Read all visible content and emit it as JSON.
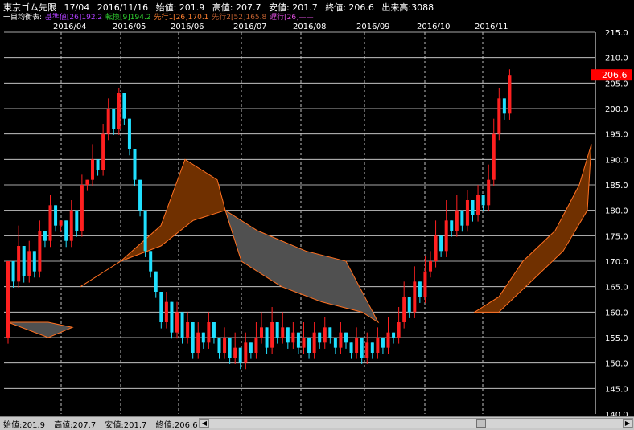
{
  "header": {
    "symbol": "東京ゴム先限",
    "contract": "17/04",
    "date": "2016/11/16",
    "open": "始値: 201.9",
    "high": "高値: 207.7",
    "low": "安値: 201.7",
    "close": "終値: 206.6",
    "volume": "出来高:3088"
  },
  "legend": {
    "prefix": "一目均衡表:",
    "kijun": "基準値[26]192.2",
    "tenkan": "転換[9]194.2",
    "senko1": "先行1[26]170.1",
    "senko2": "先行2[52]165.8",
    "chikou": "遅行[26]——"
  },
  "colors": {
    "up": "#ff2020",
    "down": "#20e0ff",
    "kijun": "#9020ff",
    "tenkan": "#20b020",
    "senko1": "#ff7020",
    "senko2": "#a05020",
    "chikou": "#d040d0",
    "cloud_bull": "#703000",
    "cloud_bear": "#505050",
    "price_tag": "#ff0000"
  },
  "footer": {
    "open": "始値:201.9",
    "high": "高値:207.7",
    "low": "安値:201.7",
    "close": "終値:206.6"
  },
  "chart_data": {
    "type": "candlestick",
    "ylim": [
      140,
      215
    ],
    "y_ticks": [
      "140.0",
      "145.0",
      "150.0",
      "155.0",
      "160.0",
      "165.0",
      "170.0",
      "175.0",
      "180.0",
      "185.0",
      "190.0",
      "195.0",
      "200.0",
      "205.0",
      "210.0",
      "215.0"
    ],
    "month_labels": [
      "2016/04",
      "2016/05",
      "2016/06",
      "2016/07",
      "2016/08",
      "2016/09",
      "2016/10",
      "2016/11"
    ],
    "last_price": "206.6",
    "candles": [
      [
        155,
        170,
        165
      ],
      [
        170,
        166,
        164
      ],
      [
        166,
        173,
        177
      ],
      [
        173,
        167,
        165
      ],
      [
        167,
        172,
        174
      ],
      [
        172,
        168,
        166
      ],
      [
        168,
        176,
        178
      ],
      [
        176,
        174,
        172
      ],
      [
        174,
        181,
        183
      ],
      [
        181,
        177,
        176
      ],
      [
        177,
        178,
        172
      ],
      [
        178,
        174,
        173
      ],
      [
        174,
        180,
        182
      ],
      [
        180,
        176,
        174
      ],
      [
        176,
        185,
        187
      ],
      [
        185,
        186,
        182
      ],
      [
        186,
        190,
        193
      ],
      [
        190,
        188,
        185
      ],
      [
        188,
        195,
        197
      ],
      [
        195,
        200,
        202
      ],
      [
        200,
        196,
        194
      ],
      [
        196,
        203,
        204
      ],
      [
        203,
        198,
        196
      ],
      [
        198,
        192,
        190
      ],
      [
        192,
        186,
        185
      ],
      [
        186,
        180,
        178
      ],
      [
        180,
        172,
        170
      ],
      [
        172,
        168,
        167
      ],
      [
        168,
        164,
        162
      ],
      [
        164,
        158,
        157
      ],
      [
        158,
        162,
        164
      ],
      [
        162,
        156,
        155
      ],
      [
        156,
        160,
        162
      ],
      [
        160,
        155,
        153
      ],
      [
        155,
        158,
        160
      ],
      [
        158,
        152,
        150
      ],
      [
        152,
        156,
        158
      ],
      [
        156,
        154,
        150
      ],
      [
        154,
        158,
        160
      ],
      [
        158,
        155,
        152
      ],
      [
        155,
        152,
        150
      ],
      [
        152,
        155,
        157
      ],
      [
        155,
        151,
        149
      ],
      [
        151,
        153,
        156
      ],
      [
        153,
        150,
        148
      ],
      [
        150,
        154,
        156
      ],
      [
        154,
        152,
        150
      ],
      [
        152,
        155,
        158
      ],
      [
        155,
        157,
        160
      ],
      [
        157,
        153,
        152
      ],
      [
        153,
        158,
        161
      ],
      [
        158,
        155,
        153
      ],
      [
        155,
        157,
        160
      ],
      [
        157,
        154,
        152
      ],
      [
        154,
        156,
        158
      ],
      [
        156,
        153,
        151
      ],
      [
        153,
        155,
        158
      ],
      [
        155,
        152,
        150
      ],
      [
        152,
        156,
        158
      ],
      [
        156,
        154,
        152
      ],
      [
        154,
        157,
        159
      ],
      [
        157,
        155,
        153
      ],
      [
        155,
        153,
        151
      ],
      [
        153,
        156,
        158
      ],
      [
        156,
        154,
        152
      ],
      [
        154,
        152,
        150
      ],
      [
        152,
        155,
        157
      ],
      [
        155,
        151,
        149
      ],
      [
        151,
        154,
        156
      ],
      [
        154,
        152,
        150
      ],
      [
        152,
        155,
        157
      ],
      [
        155,
        153,
        151
      ],
      [
        153,
        156,
        159
      ],
      [
        156,
        155,
        153
      ],
      [
        155,
        158,
        161
      ],
      [
        158,
        163,
        166
      ],
      [
        163,
        160,
        158
      ],
      [
        160,
        166,
        169
      ],
      [
        166,
        163,
        161
      ],
      [
        163,
        168,
        171
      ],
      [
        168,
        170,
        172
      ],
      [
        170,
        175,
        178
      ],
      [
        175,
        172,
        170
      ],
      [
        172,
        178,
        182
      ],
      [
        178,
        176,
        174
      ],
      [
        176,
        180,
        183
      ],
      [
        180,
        177,
        175
      ],
      [
        177,
        182,
        184
      ],
      [
        182,
        179,
        177
      ],
      [
        179,
        183,
        185
      ],
      [
        183,
        181,
        179
      ],
      [
        181,
        186,
        189
      ],
      [
        186,
        195,
        198
      ],
      [
        195,
        202,
        204
      ],
      [
        202,
        199,
        198
      ],
      [
        199,
        206.6,
        207.7
      ]
    ],
    "tenkan": [],
    "kijun": [],
    "senko1": [],
    "senko2": []
  }
}
